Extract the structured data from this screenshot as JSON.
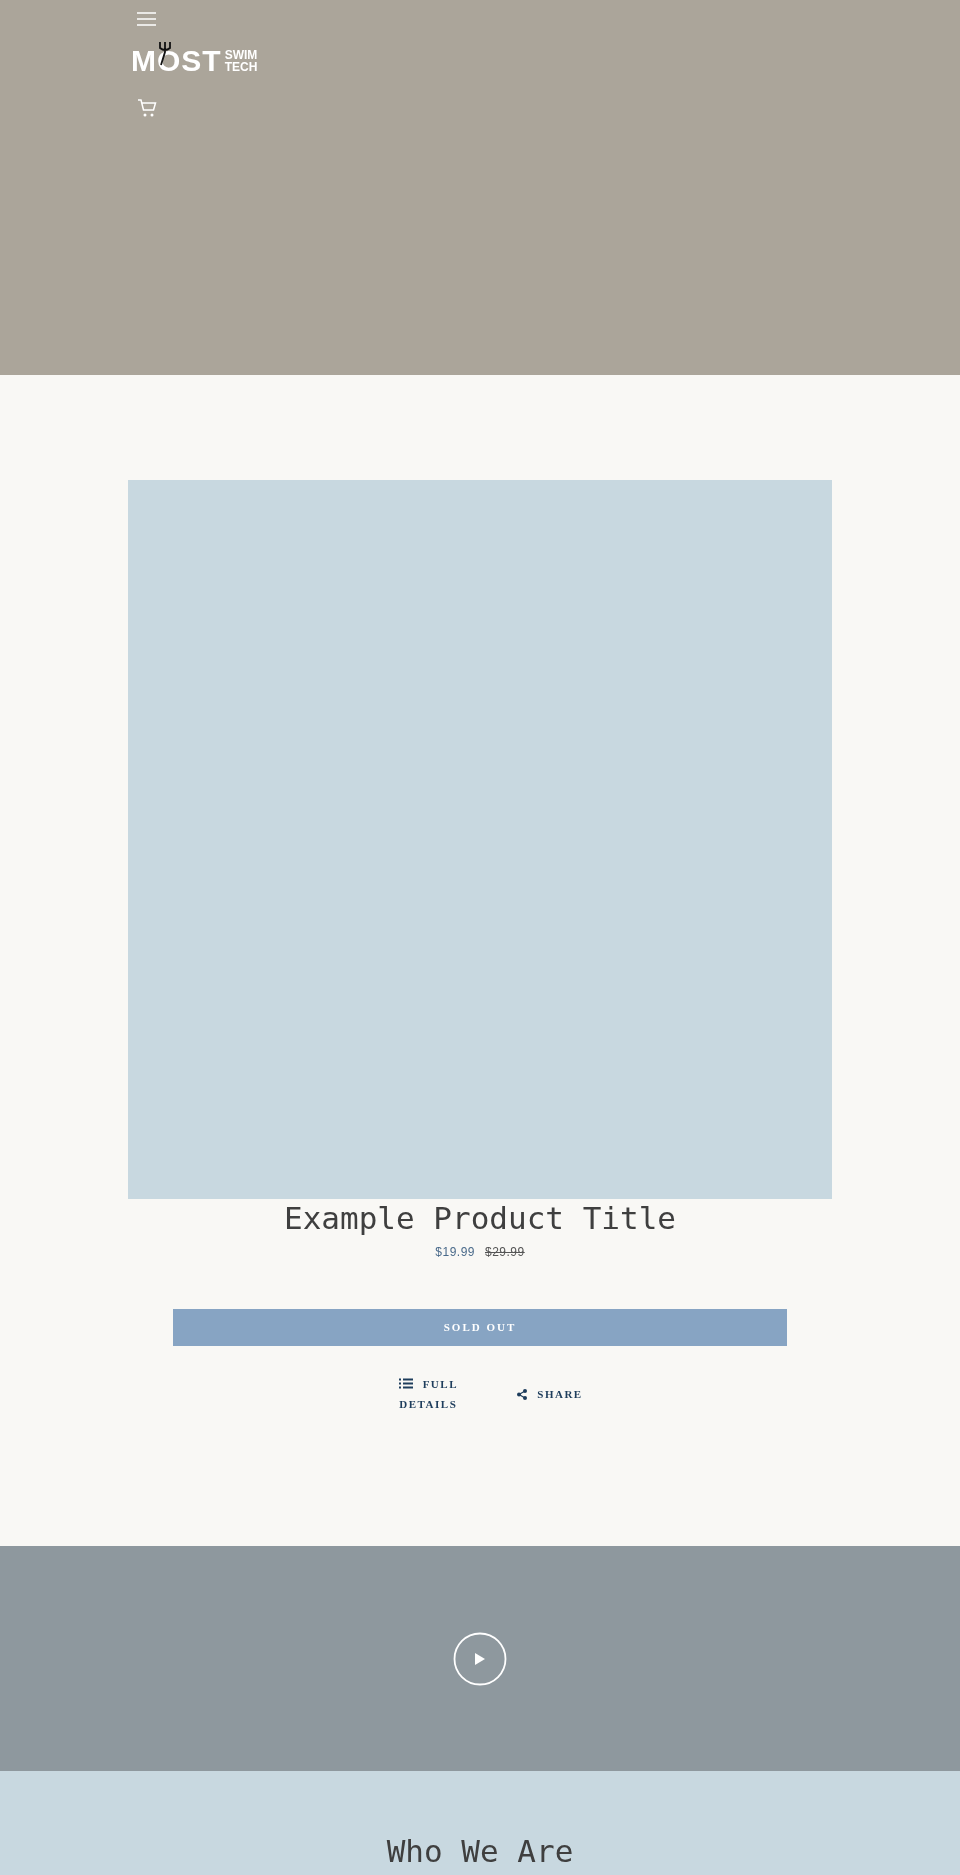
{
  "header": {
    "logo": {
      "main": "MOST",
      "sub": [
        "SWIM",
        "TECH"
      ]
    }
  },
  "product": {
    "kind": "placeholder",
    "title": "Example Product Title",
    "price": "$19.99",
    "compare_price": "$29.99",
    "sold_out_button": {
      "label": "SOLD OUT",
      "disabled": true
    },
    "links": [
      {
        "kind": "details",
        "label": "FULL DETAILS"
      },
      {
        "kind": "share",
        "label": "SHARE"
      }
    ]
  },
  "video": {
    "kind": "placeholder"
  },
  "about": {
    "title": "Who We Are"
  }
}
